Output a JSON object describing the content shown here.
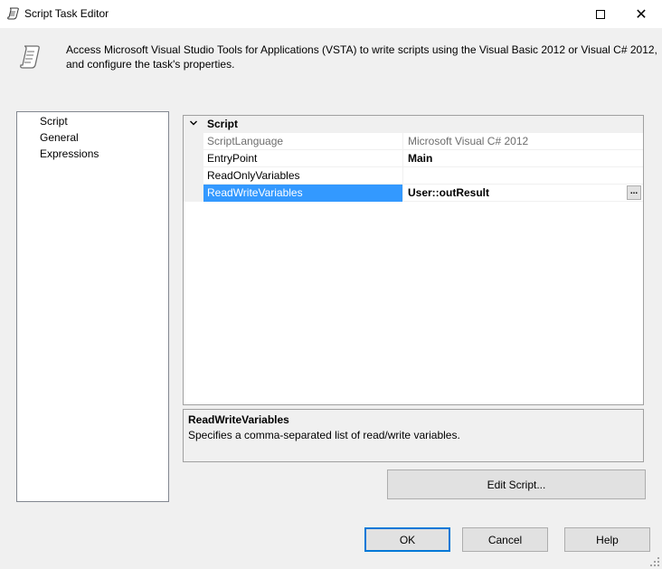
{
  "window": {
    "title": "Script Task Editor",
    "icon": "scroll-icon"
  },
  "header": {
    "line1": "Access Microsoft Visual Studio Tools for Applications (VSTA) to write scripts using the Visual Basic 2012 or Visual C# 2012,",
    "line2": "and configure the task's properties.",
    "icon": "script-scroll-icon"
  },
  "nav": {
    "items": [
      {
        "label": "Script"
      },
      {
        "label": "General"
      },
      {
        "label": "Expressions"
      }
    ]
  },
  "grid": {
    "category": "Script",
    "properties": [
      {
        "name": "ScriptLanguage",
        "value": "Microsoft Visual C# 2012"
      },
      {
        "name": "EntryPoint",
        "value": "Main"
      },
      {
        "name": "ReadOnlyVariables",
        "value": ""
      },
      {
        "name": "ReadWriteVariables",
        "value": "User::outResult"
      }
    ],
    "ellipsis": "..."
  },
  "description": {
    "title": "ReadWriteVariables",
    "text": "Specifies a comma-separated list of read/write variables."
  },
  "buttons": {
    "edit_script": "Edit Script...",
    "ok": "OK",
    "cancel": "Cancel",
    "help": "Help"
  },
  "colors": {
    "selection": "#3399ff",
    "ok_border": "#0078d7"
  }
}
